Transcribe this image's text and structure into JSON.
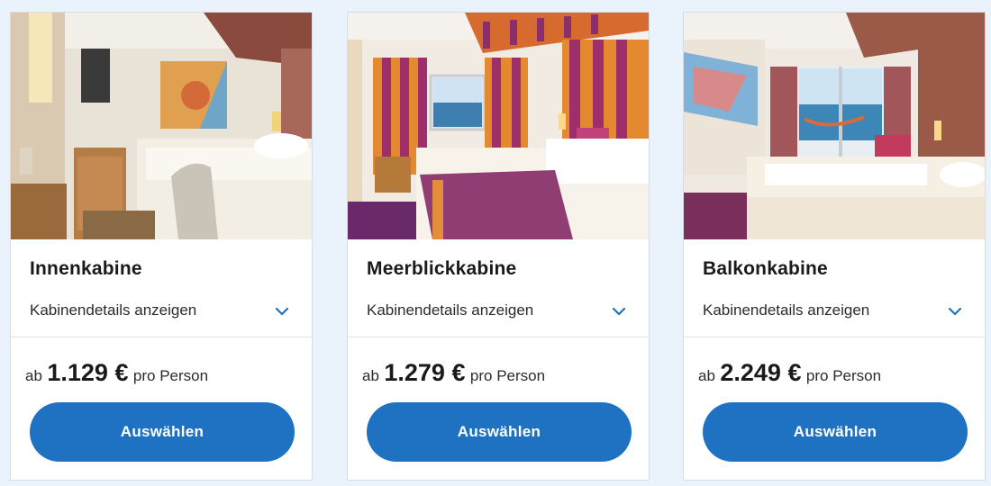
{
  "accent_color": "#1f72c2",
  "cards": [
    {
      "title": "Innenkabine",
      "details_label": "Kabinendetails anzeigen",
      "price_prefix": "ab",
      "price_amount": "1.129 €",
      "price_suffix": "pro Person",
      "button_label": "Auswählen",
      "photo": "inside-cabin-photo"
    },
    {
      "title": "Meerblickkabine",
      "details_label": "Kabinendetails anzeigen",
      "price_prefix": "ab",
      "price_amount": "1.279 €",
      "price_suffix": "pro Person",
      "button_label": "Auswählen",
      "photo": "sea-view-cabin-photo"
    },
    {
      "title": "Balkonkabine",
      "details_label": "Kabinendetails anzeigen",
      "price_prefix": "ab",
      "price_amount": "2.249 €",
      "price_suffix": "pro Person",
      "button_label": "Auswählen",
      "photo": "balcony-cabin-photo"
    }
  ]
}
